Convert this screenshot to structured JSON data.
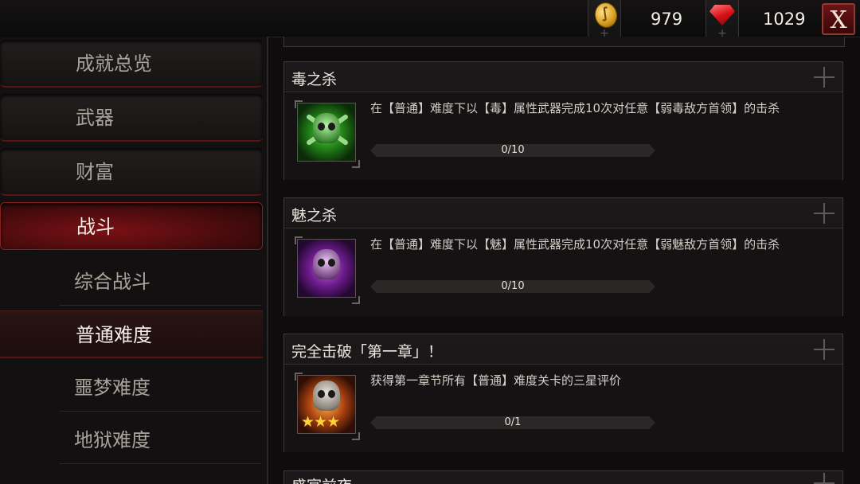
{
  "currency": {
    "gold": {
      "icon": "gold-coin-icon",
      "value": "979"
    },
    "gems": {
      "icon": "red-gem-icon",
      "value": "1029"
    }
  },
  "close_label": "X",
  "sidebar": {
    "items": [
      {
        "label": "成就总览",
        "kind": "category",
        "active": false
      },
      {
        "label": "武器",
        "kind": "category",
        "active": false
      },
      {
        "label": "财富",
        "kind": "category",
        "active": false
      },
      {
        "label": "战斗",
        "kind": "category",
        "active": true
      },
      {
        "label": "综合战斗",
        "kind": "sub",
        "selected": false
      },
      {
        "label": "普通难度",
        "kind": "sub",
        "selected": true
      },
      {
        "label": "噩梦难度",
        "kind": "sub",
        "selected": false
      },
      {
        "label": "地狱难度",
        "kind": "sub",
        "selected": false
      }
    ]
  },
  "achievements": [
    {
      "title": "毒之杀",
      "icon": "poison-skull-icon",
      "description": "在【普通】难度下以【毒】属性武器完成10次对任意【弱毒敌方首领】的击杀",
      "progress_label": "0/10",
      "progress_fraction": 0
    },
    {
      "title": "魅之杀",
      "icon": "charm-skull-icon",
      "description": "在【普通】难度下以【魅】属性武器完成10次对任意【弱魅敌方首领】的击杀",
      "progress_label": "0/10",
      "progress_fraction": 0
    },
    {
      "title": "完全击破「第一章」！",
      "icon": "three-star-skull-icon",
      "description": "获得第一章节所有【普通】难度关卡的三星评价",
      "progress_label": "0/1",
      "progress_fraction": 0
    }
  ],
  "partial_card_title": "盛宴前夜"
}
